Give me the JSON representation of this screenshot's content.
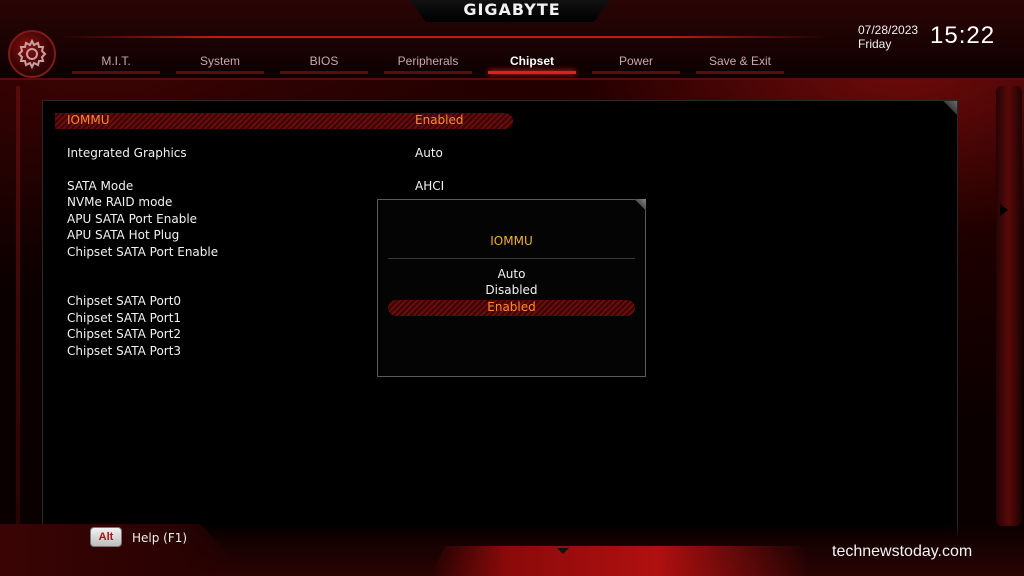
{
  "header": {
    "brand": "GIGABYTE",
    "date": "07/28/2023",
    "day": "Friday",
    "time": "15:22"
  },
  "tabs": [
    {
      "label": "M.I.T.",
      "active": false
    },
    {
      "label": "System",
      "active": false
    },
    {
      "label": "BIOS",
      "active": false
    },
    {
      "label": "Peripherals",
      "active": false
    },
    {
      "label": "Chipset",
      "active": true
    },
    {
      "label": "Power",
      "active": false
    },
    {
      "label": "Save & Exit",
      "active": false
    }
  ],
  "settings": [
    {
      "label": "IOMMU",
      "value": "Enabled",
      "selected": true
    },
    {
      "label": "Integrated Graphics",
      "value": "Auto",
      "selected": false
    },
    {
      "label": "SATA Mode",
      "value": "AHCI",
      "selected": false
    },
    {
      "label": "NVMe RAID mode",
      "value": "",
      "selected": false
    },
    {
      "label": "APU SATA Port Enable",
      "value": "",
      "selected": false
    },
    {
      "label": "APU SATA Hot Plug",
      "value": "",
      "selected": false
    },
    {
      "label": "Chipset SATA Port Enable",
      "value": "",
      "selected": false
    },
    {
      "label": "Chipset SATA Port0",
      "value": "",
      "selected": false
    },
    {
      "label": "Chipset SATA Port1",
      "value": "",
      "selected": false
    },
    {
      "label": "Chipset SATA Port2",
      "value": "",
      "selected": false
    },
    {
      "label": "Chipset SATA Port3",
      "value": "",
      "selected": false
    }
  ],
  "popup": {
    "title": "IOMMU",
    "options": [
      {
        "label": "Auto",
        "selected": false
      },
      {
        "label": "Disabled",
        "selected": false
      },
      {
        "label": "Enabled",
        "selected": true
      }
    ]
  },
  "footer": {
    "key": "Alt",
    "help": "Help (F1)"
  },
  "watermark": "technewstoday.com",
  "colors": {
    "accent_red": "#e21e1e",
    "highlight_orange": "#ff8a2e",
    "popup_title": "#f0b030"
  },
  "icons": {
    "top_left": "gear-icon"
  }
}
